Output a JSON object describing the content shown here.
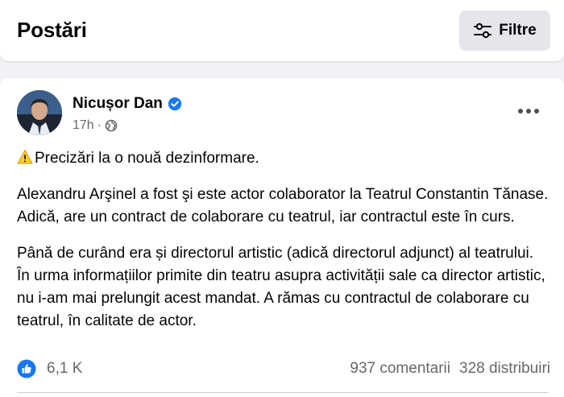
{
  "header": {
    "title": "Postări",
    "filter_label": "Filtre",
    "filter_icon": "sliders-icon"
  },
  "post": {
    "author": "Nicușor Dan",
    "verified_icon": "verified-badge-icon",
    "time": "17h",
    "separator": "·",
    "audience_icon": "globe-icon",
    "more_icon": "more-options-icon",
    "paragraphs": [
      "Precizări la o nouă dezinformare.",
      "Alexandru Arşinel a fost şi este actor colaborator la Teatrul Constantin Tănase. Adică, are un contract de colaborare cu teatrul, iar contractul este în curs.",
      "Până de curând era și directorul artistic (adică directorul adjunct) al teatrului. În urma informațiilor primite din teatru asupra activității sale ca director artistic, nu i-am mai prelungit acest mandat. A rămas cu contractul de colaborare cu teatrul, în calitate de actor."
    ],
    "warning_icon": "warning-emoji-icon",
    "reactions": {
      "icon": "like-reaction-icon",
      "count": "6,1 K"
    },
    "comments": "937 comentarii",
    "shares": "328 distribuiri"
  },
  "colors": {
    "background": "#f0f2f5",
    "card": "#ffffff",
    "accent": "#1877f2",
    "secondary_text": "#65676b"
  }
}
